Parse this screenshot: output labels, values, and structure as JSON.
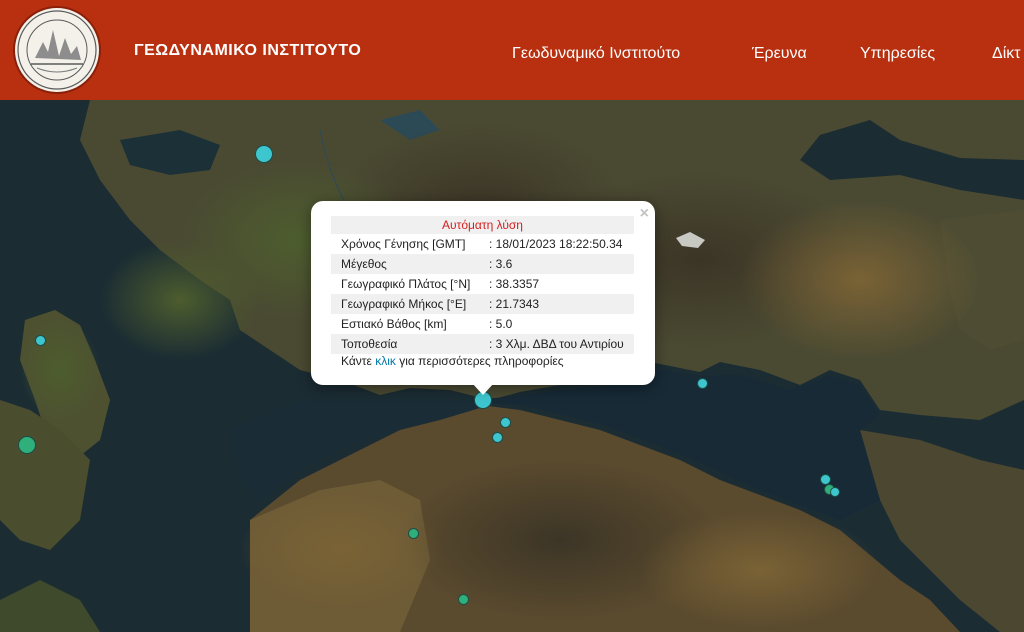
{
  "header": {
    "site_title": "ΓΕΩΔΥΝΑΜΙΚΟ ΙΝΣΤΙΤΟΥΤΟ",
    "nav": [
      "Γεωδυναμικό Ινστιτούτο",
      "Έρευνα",
      "Υπηρεσίες",
      "Δίκτ"
    ]
  },
  "popup": {
    "title": "Αυτόματη λύση",
    "close_symbol": "×",
    "rows": [
      {
        "label": "Χρόνος Γένησης [GMT]",
        "value": ": 18/01/2023 18:22:50.34"
      },
      {
        "label": "Μέγεθος",
        "value": ": 3.6"
      },
      {
        "label": "Γεωγραφικό Πλάτος [°N]",
        "value": ": 38.3357"
      },
      {
        "label": "Γεωγραφικό Μήκος [°E]",
        "value": ": 21.7343"
      },
      {
        "label": "Εστιακό Βάθος [km]",
        "value": ": 5.0"
      },
      {
        "label": "Τοποθεσία",
        "value": ": 3 Χλμ. ΔΒΔ του Αντιρίου"
      }
    ],
    "more_prefix": "Κάντε ",
    "more_link": "κλικ",
    "more_suffix": " για περισσότερες πληροφορίες"
  },
  "markers": {
    "cyan_color": "#3ec6cf",
    "green_color": "#2fb07a"
  },
  "icons": {
    "logo": "institute-seal-icon",
    "close": "close-icon"
  }
}
